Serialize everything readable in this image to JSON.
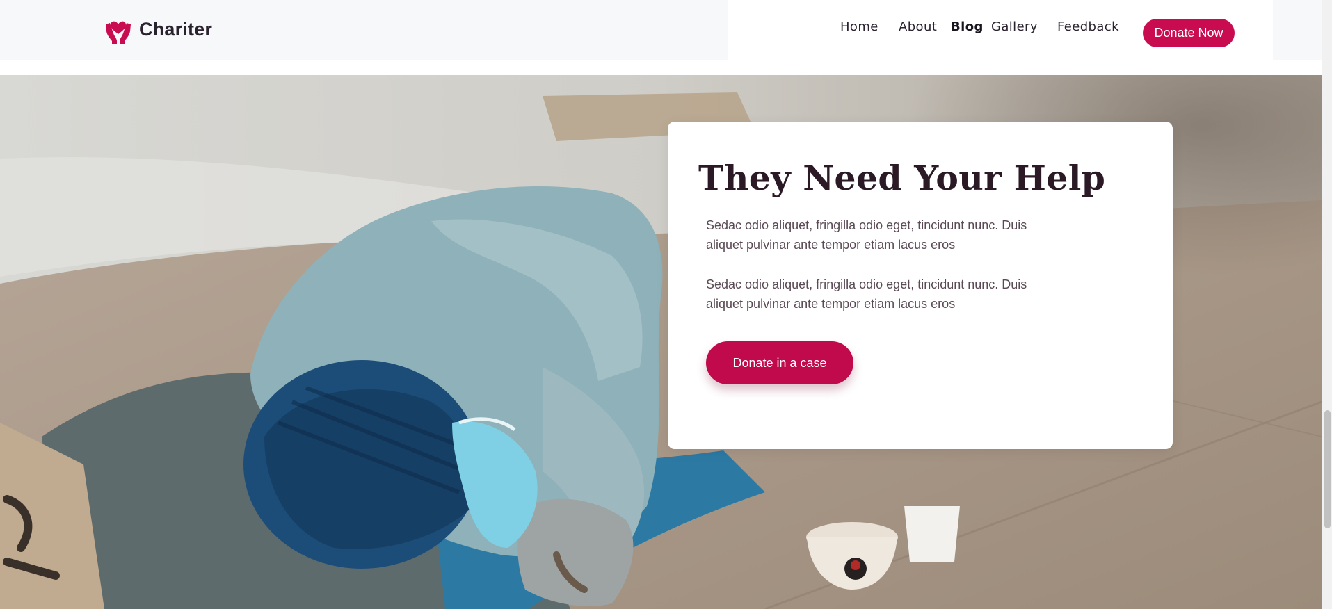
{
  "brand": {
    "name": "Chariter",
    "color": "#c90b4f"
  },
  "nav": {
    "items": [
      {
        "label": "Home"
      },
      {
        "label": "About"
      },
      {
        "label": "Blog"
      },
      {
        "label": "Gallery"
      },
      {
        "label": "Feedback"
      }
    ],
    "active": "Blog",
    "donate_label": "Donate Now"
  },
  "hero": {
    "image": "homeless-person-sleeping-on-sidewalk",
    "title": "They Need Your Help",
    "paragraphs": [
      "Sedac odio aliquet, fringilla odio eget, tincidunt nunc. Duis aliquet pulvinar ante tempor etiam lacus eros",
      "Sedac odio aliquet, fringilla odio eget, tincidunt nunc. Duis aliquet pulvinar ante tempor etiam lacus eros"
    ],
    "cta_label": "Donate in a case"
  },
  "colors": {
    "accent": "#c90b4f",
    "heading": "#2b1a26",
    "body_text": "#5a4a55",
    "header_bg": "#f7f8fa"
  }
}
